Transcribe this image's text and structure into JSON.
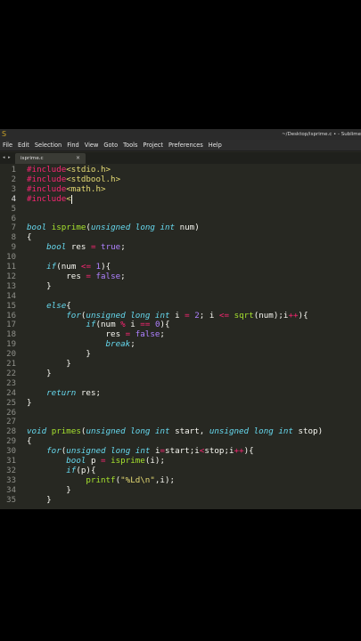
{
  "window": {
    "title": "~/Desktop/isprime.c • - Sublime",
    "menu": [
      "File",
      "Edit",
      "Selection",
      "Find",
      "View",
      "Goto",
      "Tools",
      "Project",
      "Preferences",
      "Help"
    ],
    "tab_nav": "◂ ▸",
    "tab": {
      "label": "isprime.c",
      "close": "×"
    }
  },
  "editor": {
    "current_line": 4,
    "lines": [
      {
        "n": "1",
        "text": "#include<stdio.h>"
      },
      {
        "n": "2",
        "text": "#include<stdbool.h>"
      },
      {
        "n": "3",
        "text": "#include<math.h>"
      },
      {
        "n": "4",
        "text": "#include<"
      },
      {
        "n": "5",
        "text": ""
      },
      {
        "n": "6",
        "text": ""
      },
      {
        "n": "7",
        "text": "bool isprime(unsigned long int num)"
      },
      {
        "n": "8",
        "text": "{"
      },
      {
        "n": "9",
        "text": "    bool res = true;"
      },
      {
        "n": "10",
        "text": ""
      },
      {
        "n": "11",
        "text": "    if(num <= 1){"
      },
      {
        "n": "12",
        "text": "        res = false;"
      },
      {
        "n": "13",
        "text": "    }"
      },
      {
        "n": "14",
        "text": ""
      },
      {
        "n": "15",
        "text": "    else{"
      },
      {
        "n": "16",
        "text": "        for(unsigned long int i = 2; i <= sqrt(num);i++){"
      },
      {
        "n": "17",
        "text": "            if(num % i == 0){"
      },
      {
        "n": "18",
        "text": "                res = false;"
      },
      {
        "n": "19",
        "text": "                break;"
      },
      {
        "n": "20",
        "text": "            }"
      },
      {
        "n": "21",
        "text": "        }"
      },
      {
        "n": "22",
        "text": "    }"
      },
      {
        "n": "23",
        "text": ""
      },
      {
        "n": "24",
        "text": "    return res;"
      },
      {
        "n": "25",
        "text": "}"
      },
      {
        "n": "26",
        "text": ""
      },
      {
        "n": "27",
        "text": ""
      },
      {
        "n": "28",
        "text": "void primes(unsigned long int start, unsigned long int stop)"
      },
      {
        "n": "29",
        "text": "{"
      },
      {
        "n": "30",
        "text": "    for(unsigned long int i=start;i<stop;i++){"
      },
      {
        "n": "31",
        "text": "        bool p = isprime(i);"
      },
      {
        "n": "32",
        "text": "        if(p){"
      },
      {
        "n": "33",
        "text": "            printf(\"%Ld\\n\",i);"
      },
      {
        "n": "34",
        "text": "        }"
      },
      {
        "n": "35",
        "text": "    }"
      }
    ]
  },
  "colors": {
    "background": "#272822",
    "keyword": "#66d9ef",
    "preprocessor": "#f92672",
    "function": "#a6e22e",
    "number": "#ae81ff",
    "string": "#e6db74",
    "text": "#f8f8f2",
    "gutter_text": "#8f908a"
  }
}
